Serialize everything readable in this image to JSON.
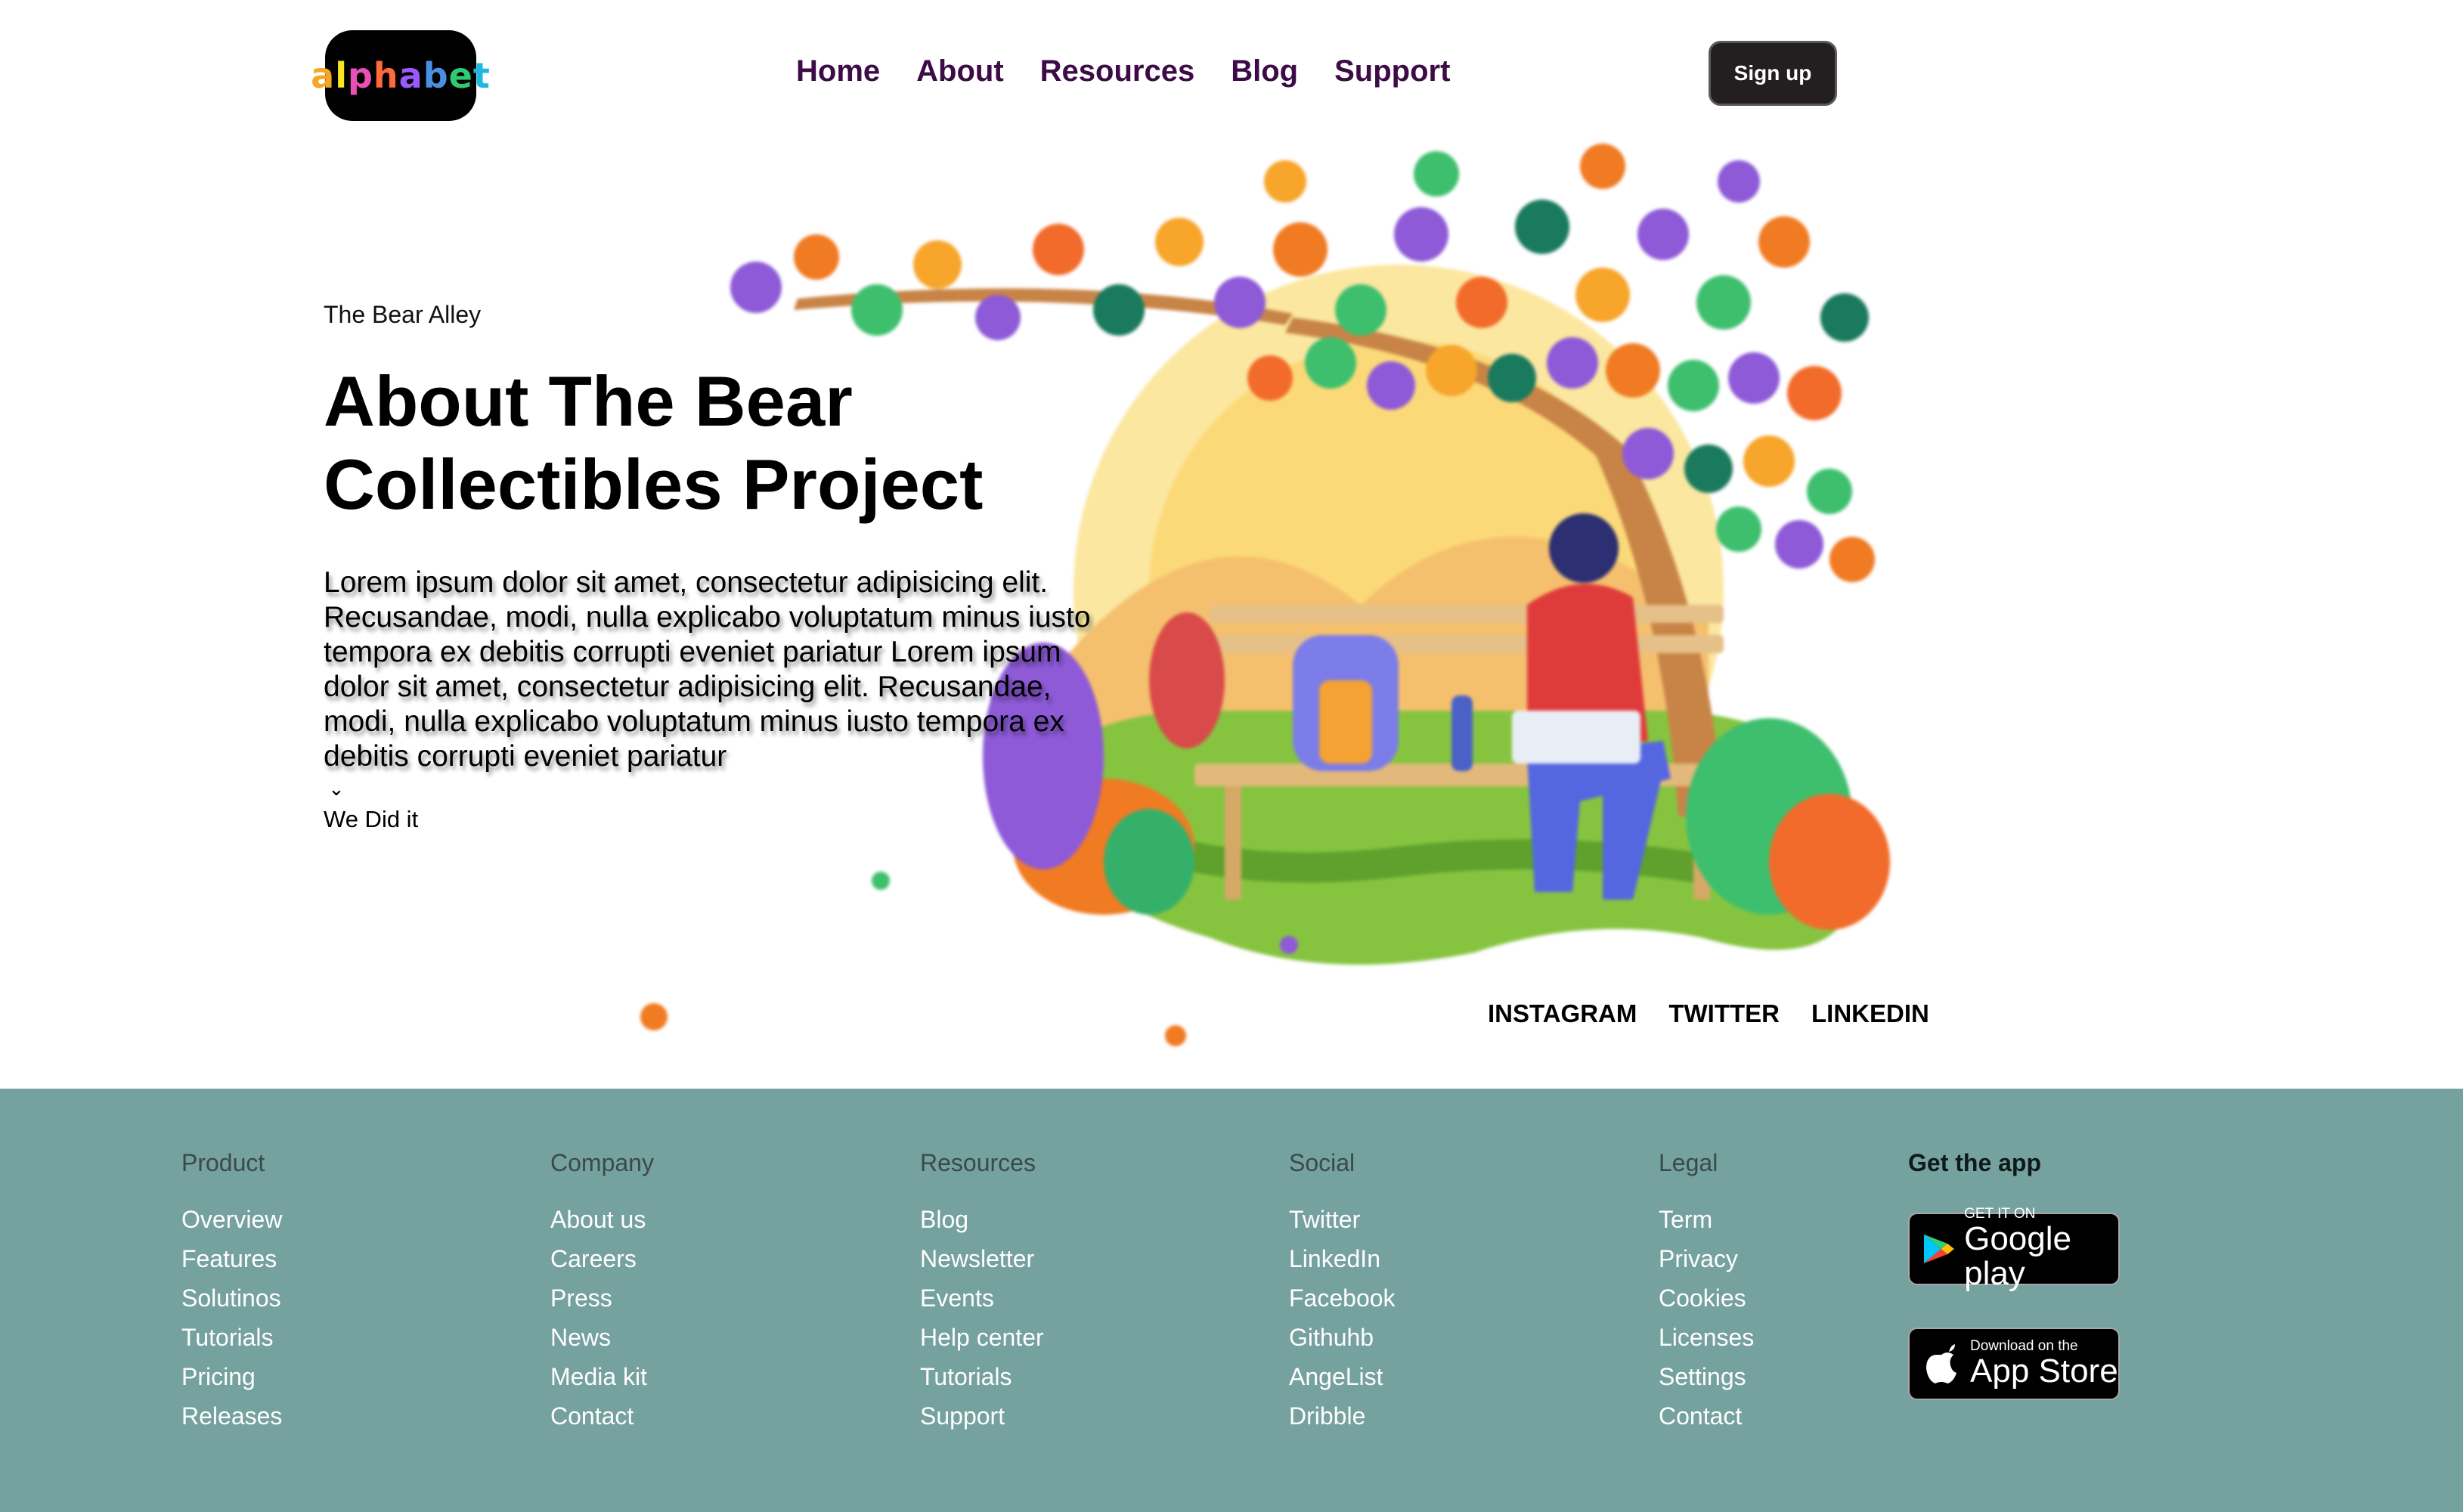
{
  "header": {
    "logo_text": "alphabet",
    "nav": [
      "Home",
      "About",
      "Resources",
      "Blog",
      "Support"
    ],
    "signup_label": "Sign up"
  },
  "hero": {
    "eyebrow": "The Bear Alley",
    "title": "About The Bear Collectibles Project",
    "body": "Lorem ipsum dolor sit amet, consectetur adipisicing elit. Recusandae, modi, nulla explicabo voluptatum minus iusto tempora ex debitis corrupti eveniet pariatur Lorem ipsum dolor sit amet, consectetur adipisicing elit. Recusandae, modi, nulla explicabo voluptatum minus iusto tempora ex debitis corrupti eveniet pariatur",
    "chevron_icon": "chevron-down-icon",
    "link": "We Did it"
  },
  "social": [
    "INSTAGRAM",
    "TWITTER",
    "LINKEDIN"
  ],
  "footer": {
    "columns": [
      {
        "title": "Product",
        "items": [
          "Overview",
          "Features",
          "Solutinos",
          "Tutorials",
          "Pricing",
          "Releases"
        ]
      },
      {
        "title": "Company",
        "items": [
          "About us",
          "Careers",
          "Press",
          "News",
          "Media kit",
          "Contact"
        ]
      },
      {
        "title": "Resources",
        "items": [
          "Blog",
          "Newsletter",
          "Events",
          "Help center",
          "Tutorials",
          "Support"
        ]
      },
      {
        "title": "Social",
        "items": [
          "Twitter",
          "LinkedIn",
          "Facebook",
          "Githuhb",
          "AngeList",
          "Dribble"
        ]
      },
      {
        "title": "Legal",
        "items": [
          "Term",
          "Privacy",
          "Cookies",
          "Licenses",
          "Settings",
          "Contact"
        ]
      }
    ],
    "app_title": "Get the app",
    "google_play": {
      "small": "GET IT ON",
      "big": "Google play"
    },
    "app_store": {
      "small": "Download on the",
      "big": "App Store"
    }
  },
  "colors": {
    "nav_text": "#3d0b46",
    "footer_bg": "#75a19f",
    "signup_bg": "#231f20"
  }
}
